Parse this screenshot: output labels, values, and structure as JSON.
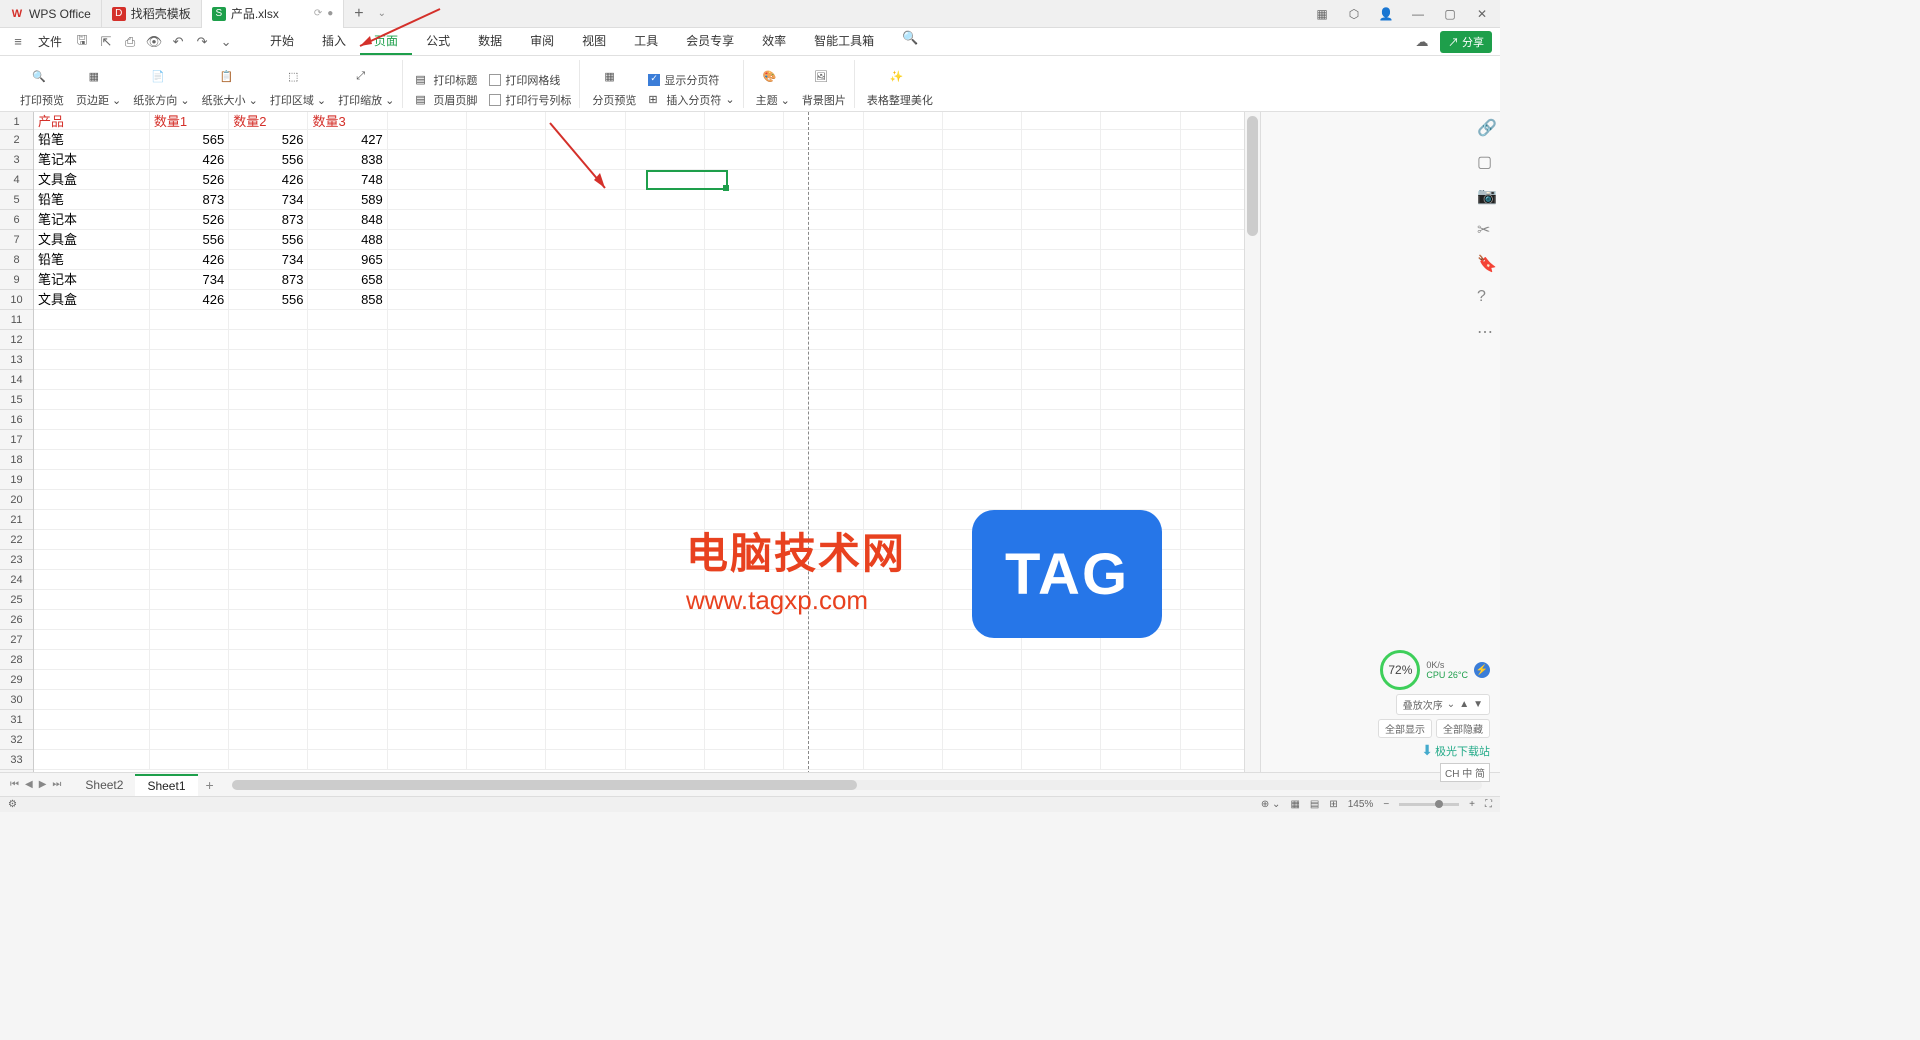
{
  "tabs": [
    {
      "label": "WPS Office",
      "icon": "wps"
    },
    {
      "label": "找稻壳模板",
      "icon": "doc"
    },
    {
      "label": "产品.xlsx",
      "icon": "sheet",
      "active": true
    }
  ],
  "file_menu": "文件",
  "menus": [
    "开始",
    "插入",
    "页面",
    "公式",
    "数据",
    "审阅",
    "视图",
    "工具",
    "会员专享",
    "效率",
    "智能工具箱"
  ],
  "active_menu": 2,
  "share_label": "分享",
  "ribbon": {
    "print_preview": "打印预览",
    "margins": "页边距",
    "orientation": "纸张方向",
    "size": "纸张大小",
    "print_area": "打印区域",
    "scale": "打印缩放",
    "fit_icon": "适合",
    "print_titles": "打印标题",
    "header_footer": "页眉页脚",
    "print_gridlines": "打印网格线",
    "print_rowcol": "打印行号列标",
    "page_break_preview": "分页预览",
    "insert_break": "插入分页符",
    "show_break": "显示分页符",
    "theme": "主题",
    "background": "背景图片",
    "beautify": "表格整理美化"
  },
  "headers": [
    "产品",
    "数量1",
    "数量2",
    "数量3"
  ],
  "rows": [
    [
      "铅笔",
      565,
      526,
      427
    ],
    [
      "笔记本",
      426,
      556,
      838
    ],
    [
      "文具盒",
      526,
      426,
      748
    ],
    [
      "铅笔",
      873,
      734,
      589
    ],
    [
      "笔记本",
      526,
      873,
      848
    ],
    [
      "文具盒",
      556,
      556,
      488
    ],
    [
      "铅笔",
      426,
      734,
      965
    ],
    [
      "笔记本",
      734,
      873,
      658
    ],
    [
      "文具盒",
      426,
      556,
      858
    ]
  ],
  "row_count": 33,
  "sheets": [
    "Sheet2",
    "Sheet1"
  ],
  "active_sheet": 1,
  "status": {
    "zoom": "145%",
    "stacking": "叠放次序",
    "show_all": "全部显示",
    "hide_all": "全部隐藏",
    "perf": "72%",
    "net": "0K/s",
    "cpu": "CPU 26°C",
    "ime": "CH 中 简"
  },
  "watermark": {
    "text": "电脑技术网",
    "url": "www.tagxp.com",
    "tag": "TAG",
    "dl": "极光下载站"
  }
}
